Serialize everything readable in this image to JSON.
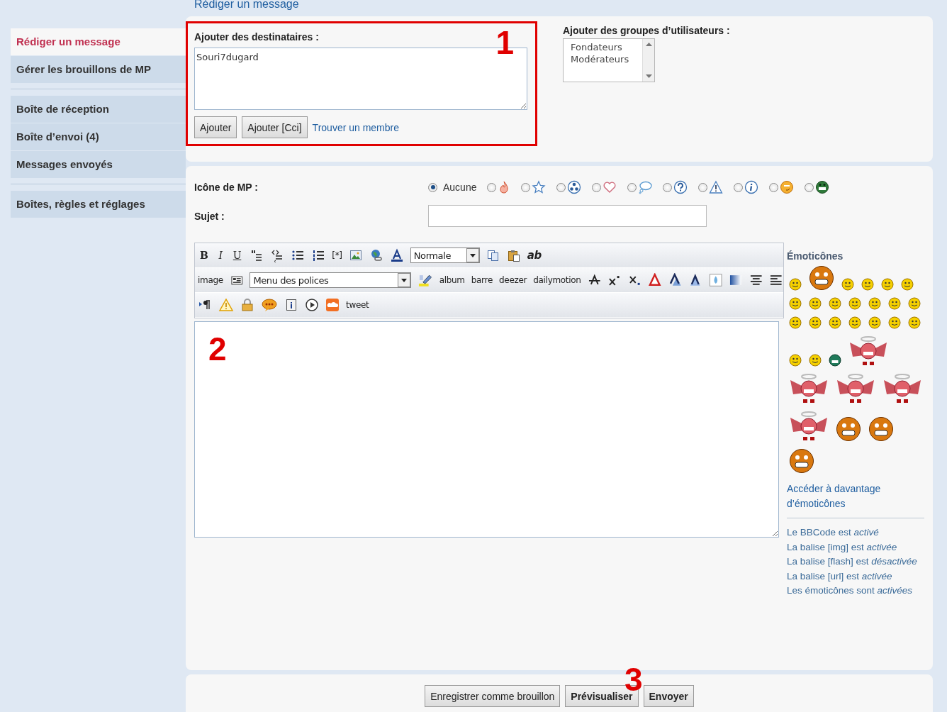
{
  "page_title": "Rédiger un message",
  "sidebar": {
    "groups": [
      [
        {
          "label": "Rédiger un message",
          "selected": true
        },
        {
          "label": "Gérer les brouillons de MP",
          "selected": false
        }
      ],
      [
        {
          "label": "Boîte de réception",
          "selected": false
        },
        {
          "label": "Boîte d’envoi (4)",
          "selected": false
        },
        {
          "label": "Messages envoyés",
          "selected": false
        }
      ],
      [
        {
          "label": "Boîtes, règles et réglages",
          "selected": false
        }
      ]
    ]
  },
  "recipients": {
    "label": "Ajouter des destinataires :",
    "value": "Souri7dugard",
    "buttons": [
      "Ajouter",
      "Ajouter [Cci]"
    ],
    "link": "Trouver un membre",
    "annotation": "1"
  },
  "user_groups": {
    "label": "Ajouter des groupes d’utilisateurs :",
    "options": [
      "Fondateurs",
      "Modérateurs"
    ]
  },
  "pm_icon": {
    "label": "Icône de MP :",
    "options": [
      {
        "kind": "none",
        "label": "Aucune",
        "selected": true
      },
      {
        "kind": "flame",
        "selected": false
      },
      {
        "kind": "star",
        "selected": false
      },
      {
        "kind": "radiation",
        "selected": false
      },
      {
        "kind": "heart",
        "selected": false
      },
      {
        "kind": "bubble",
        "selected": false
      },
      {
        "kind": "question",
        "selected": false
      },
      {
        "kind": "warning",
        "selected": false
      },
      {
        "kind": "info",
        "selected": false
      },
      {
        "kind": "face",
        "selected": false
      },
      {
        "kind": "grin",
        "selected": false
      }
    ]
  },
  "subject": {
    "label": "Sujet :"
  },
  "toolbar": {
    "rows": [
      [
        {
          "kind": "bold",
          "text": "B"
        },
        {
          "kind": "italic",
          "text": "I"
        },
        {
          "kind": "underline",
          "text": "U"
        },
        {
          "kind": "quote"
        },
        {
          "kind": "code"
        },
        {
          "kind": "bullets"
        },
        {
          "kind": "numbers"
        },
        {
          "kind": "text",
          "text": "[*]"
        },
        {
          "kind": "picture"
        },
        {
          "kind": "globe"
        },
        {
          "kind": "fontcolor"
        },
        {
          "kind": "select",
          "text": "Normale"
        },
        {
          "kind": "copy"
        },
        {
          "kind": "paste"
        },
        {
          "kind": "bolditalic",
          "text": "ab"
        }
      ],
      [
        {
          "kind": "text",
          "text": "image"
        },
        {
          "kind": "stripes"
        },
        {
          "kind": "select",
          "text": "Menu des polices"
        },
        {
          "kind": "highlighter"
        },
        {
          "kind": "text",
          "text": "album"
        },
        {
          "kind": "text",
          "text": "barre"
        },
        {
          "kind": "text",
          "text": "deezer"
        },
        {
          "kind": "text",
          "text": "dailymotion"
        },
        {
          "kind": "strike"
        },
        {
          "kind": "sup"
        },
        {
          "kind": "sub"
        },
        {
          "kind": "outline"
        },
        {
          "kind": "shadow"
        },
        {
          "kind": "glow"
        },
        {
          "kind": "drop"
        },
        {
          "kind": "gradient"
        },
        {
          "kind": "center"
        },
        {
          "kind": "justify"
        }
      ],
      [
        {
          "kind": "pilcrow"
        },
        {
          "kind": "warning"
        },
        {
          "kind": "lock"
        },
        {
          "kind": "bubble"
        },
        {
          "kind": "document"
        },
        {
          "kind": "play"
        },
        {
          "kind": "cloud"
        },
        {
          "kind": "text",
          "text": "tweet"
        }
      ]
    ]
  },
  "message": {
    "annotation": "2"
  },
  "emoticons": {
    "title": "Émoticônes",
    "items": [
      {
        "kind": "smiley"
      },
      {
        "kind": "big"
      },
      {
        "kind": "smiley"
      },
      {
        "kind": "smiley"
      },
      {
        "kind": "smiley"
      },
      {
        "kind": "smiley"
      },
      {
        "kind": "smiley"
      },
      {
        "kind": "smiley"
      },
      {
        "kind": "smiley"
      },
      {
        "kind": "smiley"
      },
      {
        "kind": "smiley"
      },
      {
        "kind": "smiley"
      },
      {
        "kind": "smiley"
      },
      {
        "kind": "smiley"
      },
      {
        "kind": "smiley"
      },
      {
        "kind": "smiley"
      },
      {
        "kind": "smiley"
      },
      {
        "kind": "smiley"
      },
      {
        "kind": "smiley"
      },
      {
        "kind": "smiley"
      },
      {
        "kind": "smiley"
      },
      {
        "kind": "smiley"
      },
      {
        "kind": "green"
      },
      {
        "kind": "angel"
      },
      {
        "kind": "angel"
      },
      {
        "kind": "angel"
      },
      {
        "kind": "angel"
      },
      {
        "kind": "angel"
      },
      {
        "kind": "big"
      },
      {
        "kind": "big"
      },
      {
        "kind": "big"
      }
    ],
    "more_link": "Accéder à davantage d’émoticônes",
    "status": [
      "Le BBCode est *activé*",
      "La balise [img] est *activée*",
      "La balise [flash] est *désactivée*",
      "La balise [url] est *activée*",
      "Les émoticônes sont *activées*"
    ]
  },
  "actions": {
    "buttons": [
      {
        "label": "Enregistrer comme brouillon",
        "bold": false
      },
      {
        "label": "Prévisualiser",
        "bold": true
      },
      {
        "label": "Envoyer",
        "bold": true
      }
    ],
    "annotation": "3"
  }
}
